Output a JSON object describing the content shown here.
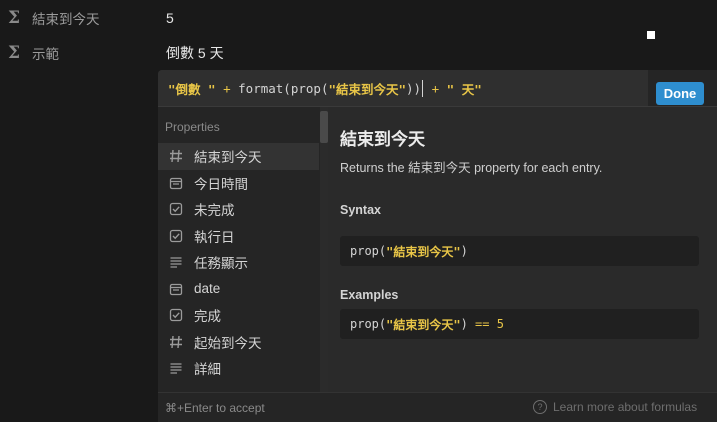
{
  "properties_rows": [
    {
      "icon": "sigma-icon",
      "name": "結束到今天",
      "value": "5"
    },
    {
      "icon": "sigma-icon",
      "name": "示範",
      "value": "倒數 5 天"
    }
  ],
  "formula": {
    "tok1": "\"倒數 \"",
    "tok2": " + ",
    "tok3": "format(prop(",
    "tok4": "\"結束到今天\"",
    "tok5": "))",
    "tok6": " + ",
    "tok7": "\" 天\""
  },
  "done_label": "Done",
  "sidebar": {
    "title": "Properties",
    "items": [
      {
        "icon": "hash-icon",
        "label": "結束到今天",
        "selected": true
      },
      {
        "icon": "calendar-icon",
        "label": "今日時間"
      },
      {
        "icon": "checkbox-icon",
        "label": "未完成"
      },
      {
        "icon": "checkbox-icon",
        "label": "執行日"
      },
      {
        "icon": "text-lines-icon",
        "label": "任務顯示"
      },
      {
        "icon": "calendar-icon",
        "label": "date"
      },
      {
        "icon": "checkbox-icon",
        "label": "完成"
      },
      {
        "icon": "hash-icon",
        "label": "起始到今天"
      },
      {
        "icon": "text-lines-icon",
        "label": "詳細"
      }
    ]
  },
  "detail": {
    "title": "結束到今天",
    "desc_prefix": "Returns the ",
    "desc_name": "結束到今天",
    "desc_suffix": " property for each entry.",
    "syntax_heading": "Syntax",
    "syntax_fn": "prop(",
    "syntax_arg": "\"結束到今天\"",
    "syntax_close": ")",
    "examples_heading": "Examples",
    "ex_fn": "prop(",
    "ex_arg": "\"結束到今天\"",
    "ex_close": ") ",
    "ex_op": "==",
    "ex_num": " 5"
  },
  "footer": {
    "hint": "⌘+Enter to accept",
    "learn_more": "Learn more about formulas"
  },
  "colors": {
    "accent": "#2e8ecf",
    "string_token": "#e8c547",
    "background": "#191919"
  }
}
